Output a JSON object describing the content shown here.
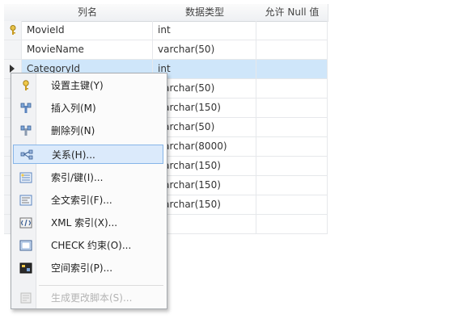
{
  "grid": {
    "headers": {
      "column_name": "列名",
      "data_type": "数据类型",
      "allow_null": "允许 Null 值"
    },
    "rows": [
      {
        "name": "MovieId",
        "type": "int",
        "allow_null": false
      },
      {
        "name": "MovieName",
        "type": "varchar(50)",
        "allow_null": false
      },
      {
        "name": "CategoryId",
        "type": "int",
        "allow_null": false
      },
      {
        "name": "",
        "type": "varchar(50)",
        "allow_null": true
      },
      {
        "name": "",
        "type": "varchar(150)",
        "allow_null": true
      },
      {
        "name": "",
        "type": "varchar(50)",
        "allow_null": true
      },
      {
        "name": "",
        "type": "varchar(8000)",
        "allow_null": true
      },
      {
        "name": "",
        "type": "varchar(150)",
        "allow_null": true
      },
      {
        "name": "",
        "type": "varchar(150)",
        "allow_null": true
      },
      {
        "name": "",
        "type": "varchar(150)",
        "allow_null": true
      },
      {
        "name": "",
        "type": "",
        "allow_null": false
      }
    ]
  },
  "context_menu": {
    "items": [
      {
        "label": "设置主键(Y)",
        "icon": "key-icon",
        "enabled": true
      },
      {
        "label": "插入列(M)",
        "icon": "insert-column-icon",
        "enabled": true
      },
      {
        "label": "删除列(N)",
        "icon": "delete-column-icon",
        "enabled": true
      },
      {
        "label": "关系(H)...",
        "icon": "relationship-icon",
        "enabled": true,
        "highlighted": true
      },
      {
        "label": "索引/键(I)...",
        "icon": "index-icon",
        "enabled": true
      },
      {
        "label": "全文索引(F)...",
        "icon": "fulltext-index-icon",
        "enabled": true
      },
      {
        "label": "XML 索引(X)...",
        "icon": "xml-index-icon",
        "enabled": true
      },
      {
        "label": "CHECK 约束(O)...",
        "icon": "check-constraint-icon",
        "enabled": true
      },
      {
        "label": "空间索引(P)...",
        "icon": "spatial-index-icon",
        "enabled": true
      },
      {
        "label": "生成更改脚本(S)...",
        "icon": "script-icon",
        "enabled": false
      }
    ]
  },
  "colors": {
    "selected_row": "#cfe6fa",
    "menu_highlight": "#dbeafb",
    "menu_border": "#86b5e8"
  }
}
